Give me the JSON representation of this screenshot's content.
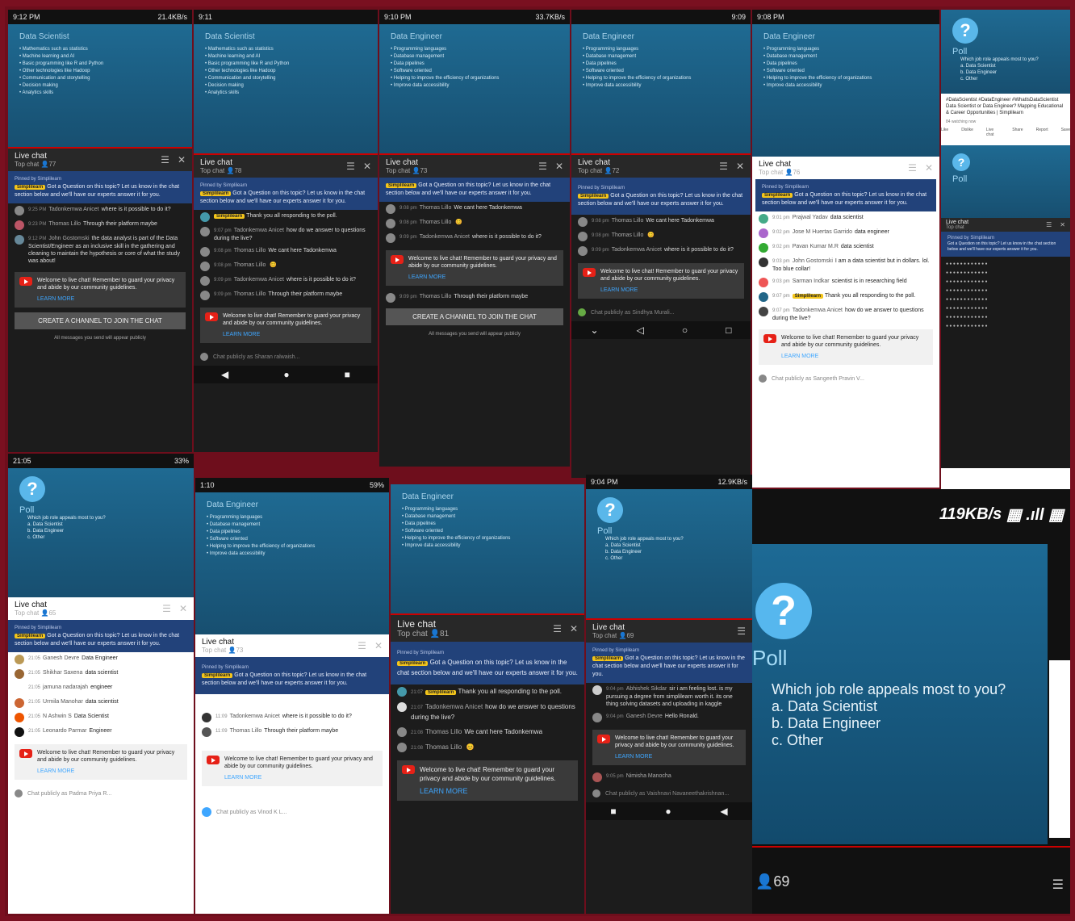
{
  "slides": {
    "scientist": {
      "title": "Data Scientist",
      "items": [
        "Mathematics such as statistics",
        "Machine learning and AI",
        "Basic programming like R and Python",
        "Other technologies like Hadoop",
        "Communication and storytelling",
        "Decision making",
        "Analytics skills"
      ]
    },
    "engineer": {
      "title": "Data Engineer",
      "items": [
        "Programming languages",
        "Database management",
        "Data pipelines",
        "Software oriented",
        "Helping to improve the efficiency of organizations",
        "Improve data accessibility"
      ]
    },
    "poll": {
      "label": "Poll",
      "question": "Which job role appeals most to you?",
      "options": [
        "a. Data Scientist",
        "b. Data Engineer",
        "c. Other"
      ]
    }
  },
  "chat": {
    "title": "Live chat",
    "subtitle": "Top chat",
    "pinned_by": "Pinned by Simplilearn",
    "chip": "Simplilearn",
    "pinned_text": "Got a Question on this topic? Let us know in the chat section below and we'll have our experts answer it for you.",
    "welcome": "Welcome to live chat! Remember to guard your privacy and abide by our community guidelines.",
    "learn_more": "LEARN MORE",
    "create_channel": "CREATE A CHANNEL TO JOIN THE CHAT",
    "public_note": "All messages you send will appear publicly",
    "thanks": "Thank you all responding to the poll."
  },
  "tiles": [
    {
      "status_left": "9:12 PM",
      "status_right": "21.4KB/s",
      "count": "77",
      "input": "",
      "messages": [
        {
          "time": "9:25 PM",
          "name": "Tadonkemwa Anicet",
          "text": "where is it possible to do it?"
        },
        {
          "time": "9:23 PM",
          "name": "Thomas Lillo",
          "text": "Through their platform maybe"
        },
        {
          "time": "9:12 PM",
          "name": "John Gostomski",
          "text": "the data analyst is part of the Data Scientist/Engineer as an inclusive skill in the gathering and cleaning to maintain the hypothesis or core of what the study was about!"
        }
      ]
    },
    {
      "status_left": "9:11",
      "status_right": "",
      "count": "78",
      "input": "Chat publicly as Sharan ralwaish...",
      "messages": [
        {
          "time": "9:07 pm",
          "name": "Tadonkemwa Anicet",
          "text": "how do we answer to questions during the live?"
        },
        {
          "time": "9:08 pm",
          "name": "Thomas Lillo",
          "text": "We cant here Tadonkemwa"
        },
        {
          "time": "9:08 pm",
          "name": "Thomas Lillo",
          "text": ""
        },
        {
          "time": "9:09 pm",
          "name": "Tadonkemwa Anicet",
          "text": "where is it possible to do it?"
        },
        {
          "time": "9:09 pm",
          "name": "Thomas Lillo",
          "text": "Through their platform maybe"
        }
      ]
    },
    {
      "status_left": "9:10 PM",
      "status_right": "33.7KB/s",
      "count": "73",
      "input": "",
      "messages": [
        {
          "time": "9:08 pm",
          "name": "Thomas Lillo",
          "text": "We cant here Tadonkemwa"
        },
        {
          "time": "9:08 pm",
          "name": "Thomas Lillo",
          "text": ""
        },
        {
          "time": "9:09 pm",
          "name": "Tadonkemwa Anicet",
          "text": "where is it possible to do it?"
        },
        {
          "time": "9:09 pm",
          "name": "Thomas Lillo",
          "text": "Through their platform maybe"
        }
      ]
    },
    {
      "status_left": "",
      "status_right": "9:09",
      "count": "72",
      "input": "Chat publicly as Sindhya Murali...",
      "messages": [
        {
          "time": "9:08 pm",
          "name": "Thomas Lillo",
          "text": "We cant here Tadonkemwa"
        },
        {
          "time": "9:08 pm",
          "name": "Thomas Lillo",
          "text": ""
        },
        {
          "time": "9:09 pm",
          "name": "Tadonkemwa Anicet",
          "text": "where is it possible to do it?"
        }
      ]
    },
    {
      "status_left": "9:08 PM",
      "status_right": "",
      "count": "76",
      "input": "Chat publicly as Sangeeth Pravin V...",
      "messages": [
        {
          "time": "9:01 pm",
          "name": "Prajwal Yadav",
          "text": "data scientist"
        },
        {
          "time": "9:02 pm",
          "name": "Jose M Huertas Garrido",
          "text": "data engineer"
        },
        {
          "time": "9:02 pm",
          "name": "Pavan Kumar M.R",
          "text": "data scientist"
        },
        {
          "time": "9:03 pm",
          "name": "John Gostomski",
          "text": "I am a data scientist but in dollars. lol. Too blue collar!"
        },
        {
          "time": "9:03 pm",
          "name": "Sarman Indkar",
          "text": "scientist is in researching field"
        },
        {
          "time": "9:07 pm",
          "name": "Simplilearn",
          "text": "Thank you all responding to the poll."
        },
        {
          "time": "9:07 pm",
          "name": "Tadonkemwa Anicet",
          "text": "how do we answer to questions during the live?"
        }
      ]
    },
    {
      "status_left": "21:05",
      "status_right": "33%",
      "count": "65",
      "input": "Chat publicly as Padma Priya R...",
      "messages": [
        {
          "time": "21:05",
          "name": "Ganesh Devre",
          "text": "Data Engineer"
        },
        {
          "time": "21:05",
          "name": "Shikhar Saxena",
          "text": "data scientist"
        },
        {
          "time": "21:05",
          "name": "jamuna nadarajah",
          "text": "engineer"
        },
        {
          "time": "21:05",
          "name": "Urmila Manohar",
          "text": "data scientist"
        },
        {
          "time": "21:05",
          "name": "N Ashwin S",
          "text": "Data Scientist"
        },
        {
          "time": "21:05",
          "name": "Leonardo Parmar",
          "text": "Engineer"
        }
      ]
    },
    {
      "status_left": "1:10",
      "status_right": "59%",
      "count": "73",
      "input": "Chat publicly as Vinod K L...",
      "messages": [
        {
          "time": "11:09",
          "name": "Tadonkemwa Anicet",
          "text": "where is it possible to do it?"
        },
        {
          "time": "11:09",
          "name": "Thomas Lillo",
          "text": "Through their platform maybe"
        }
      ]
    },
    {
      "status_left": "",
      "status_right": "",
      "count": "81",
      "input": "",
      "messages": [
        {
          "time": "21:07",
          "name": "Simplilearn",
          "text": "Thank you all responding to the poll."
        },
        {
          "time": "21:07",
          "name": "Tadonkemwa Anicet",
          "text": "how do we answer to questions during the live?"
        },
        {
          "time": "21:08",
          "name": "Thomas Lillo",
          "text": "We cant here Tadonkemwa"
        },
        {
          "time": "21:08",
          "name": "Thomas Lillo",
          "text": ""
        }
      ]
    },
    {
      "status_left": "9:04 PM",
      "status_right": "12.9KB/s",
      "count": "69",
      "input": "Chat publicly as Vaishnavi Navaneethakrishnan...",
      "messages": [
        {
          "time": "9:04 pm",
          "name": "Abhishek Sikdar",
          "text": "sir i am feeling lost. is my pursuing a degree from simplilearn worth it. its one thing solving datasets and uploading in kaggle"
        },
        {
          "time": "9:04 pm",
          "name": "Ganesh Devre",
          "text": "Hello Ronald."
        },
        {
          "time": "9:05 pm",
          "name": "Nimisha Manocha",
          "text": ""
        }
      ]
    }
  ],
  "video_card": {
    "title": "#DataScientist #DataEngineer #WhatIsDataScientist Data Scientist or Data Engineer? Mapping Educational & Career Opportunities | Simplilearn",
    "meta": "84 watching now",
    "actions": [
      "Like",
      "Dislike",
      "Live chat",
      "Share",
      "Report",
      "Save"
    ]
  },
  "large_poll": {
    "speed": "119KB/s",
    "count": "69"
  }
}
